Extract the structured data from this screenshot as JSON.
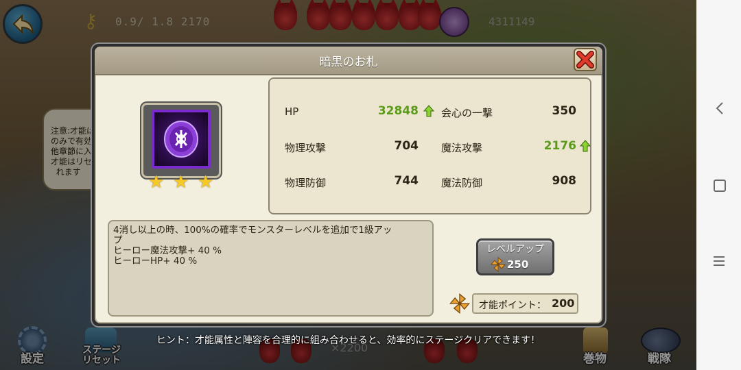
{
  "hud": {
    "progress_text": "0.9/ 1.8 2170",
    "gold_text": "4311149"
  },
  "note": {
    "text": "注意:才能は\nのみで有効\n他章節に入\n才能はリセ\n  れます"
  },
  "dialog": {
    "title": "暗黒のお札",
    "item": {
      "name": "暗黒のお札",
      "stars": 3,
      "icon": "dark-talisman-icon",
      "frame_color": "#7a2ad0"
    },
    "stats": [
      {
        "label": "HP",
        "value": "32848",
        "increased": true
      },
      {
        "label": "会心の一撃",
        "value": "350",
        "increased": false
      },
      {
        "label": "物理攻撃",
        "value": "704",
        "increased": false
      },
      {
        "label": "魔法攻撃",
        "value": "2176",
        "increased": true
      },
      {
        "label": "物理防御",
        "value": "744",
        "increased": false
      },
      {
        "label": "魔法防御",
        "value": "908",
        "increased": false
      }
    ],
    "description": [
      "4消し以上の時、100%の確率でモンスターレベルを追加で1級アッ",
      "プ",
      "ヒーロー魔法攻撃+ 40 %",
      "ヒーローHP+ 40 %"
    ],
    "level_up": {
      "label": "レベルアップ",
      "cost": "250"
    },
    "talent_points": {
      "label": "才能ポイント：",
      "value": "200"
    }
  },
  "bottom_bar": {
    "settings_label": "設定",
    "stage_label": "ステージリセット",
    "scroll_label": "巻物",
    "team_label": "戦隊",
    "count_text": "×2200"
  },
  "hint": "ヒント：才能属性と陣容を合理的に組み合わせると、効率的にステージクリアできます！",
  "colors": {
    "stat_up_green": "#5c9a1c",
    "dialog_bg": "#f2efdf",
    "title_bar": "#a39a84"
  }
}
